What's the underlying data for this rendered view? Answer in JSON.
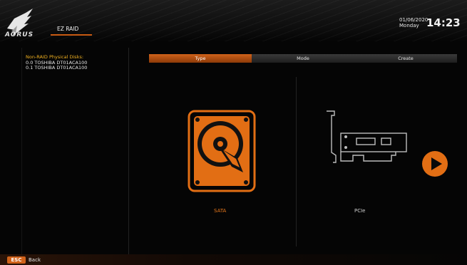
{
  "header": {
    "brand": "AORUS",
    "tab_label": "EZ RAID",
    "date": "01/06/2020",
    "day": "Monday",
    "time": "14:23"
  },
  "disks": {
    "title": "Non-RAID Physical Disks:",
    "items": [
      "0.0  TOSHIBA DT01ACA100",
      "0.1  TOSHIBA DT01ACA100"
    ]
  },
  "tabs": [
    {
      "label": "Type",
      "active": true
    },
    {
      "label": "Mode",
      "active": false
    },
    {
      "label": "Create",
      "active": false
    }
  ],
  "options": {
    "sata": {
      "label": "SATA",
      "icon": "hard-disk-icon",
      "selected": true
    },
    "pcie": {
      "label": "PCIe",
      "icon": "pcie-card-icon",
      "selected": false
    }
  },
  "next_icon": "play-arrow-icon",
  "footer": {
    "esc_key": "ESC",
    "back_label": "Back"
  },
  "colors": {
    "accent": "#d0621a",
    "warning_text": "#f0b020",
    "background": "#050505"
  }
}
